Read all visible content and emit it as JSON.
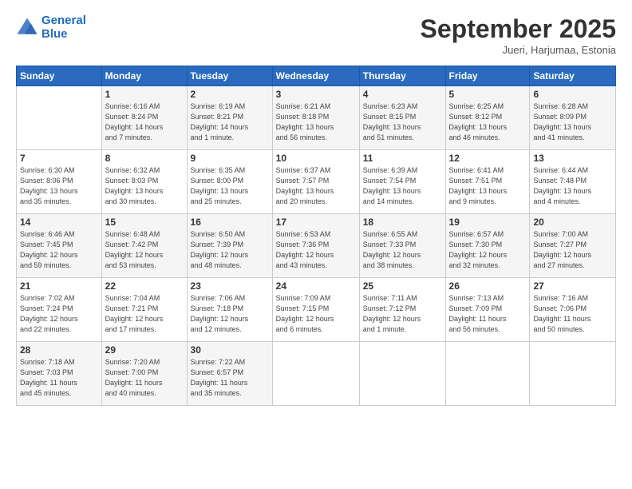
{
  "header": {
    "logo_line1": "General",
    "logo_line2": "Blue",
    "month": "September 2025",
    "location": "Jueri, Harjumaa, Estonia"
  },
  "weekdays": [
    "Sunday",
    "Monday",
    "Tuesday",
    "Wednesday",
    "Thursday",
    "Friday",
    "Saturday"
  ],
  "weeks": [
    [
      {
        "day": "",
        "info": ""
      },
      {
        "day": "1",
        "info": "Sunrise: 6:16 AM\nSunset: 8:24 PM\nDaylight: 14 hours\nand 7 minutes."
      },
      {
        "day": "2",
        "info": "Sunrise: 6:19 AM\nSunset: 8:21 PM\nDaylight: 14 hours\nand 1 minute."
      },
      {
        "day": "3",
        "info": "Sunrise: 6:21 AM\nSunset: 8:18 PM\nDaylight: 13 hours\nand 56 minutes."
      },
      {
        "day": "4",
        "info": "Sunrise: 6:23 AM\nSunset: 8:15 PM\nDaylight: 13 hours\nand 51 minutes."
      },
      {
        "day": "5",
        "info": "Sunrise: 6:25 AM\nSunset: 8:12 PM\nDaylight: 13 hours\nand 46 minutes."
      },
      {
        "day": "6",
        "info": "Sunrise: 6:28 AM\nSunset: 8:09 PM\nDaylight: 13 hours\nand 41 minutes."
      }
    ],
    [
      {
        "day": "7",
        "info": "Sunrise: 6:30 AM\nSunset: 8:06 PM\nDaylight: 13 hours\nand 35 minutes."
      },
      {
        "day": "8",
        "info": "Sunrise: 6:32 AM\nSunset: 8:03 PM\nDaylight: 13 hours\nand 30 minutes."
      },
      {
        "day": "9",
        "info": "Sunrise: 6:35 AM\nSunset: 8:00 PM\nDaylight: 13 hours\nand 25 minutes."
      },
      {
        "day": "10",
        "info": "Sunrise: 6:37 AM\nSunset: 7:57 PM\nDaylight: 13 hours\nand 20 minutes."
      },
      {
        "day": "11",
        "info": "Sunrise: 6:39 AM\nSunset: 7:54 PM\nDaylight: 13 hours\nand 14 minutes."
      },
      {
        "day": "12",
        "info": "Sunrise: 6:41 AM\nSunset: 7:51 PM\nDaylight: 13 hours\nand 9 minutes."
      },
      {
        "day": "13",
        "info": "Sunrise: 6:44 AM\nSunset: 7:48 PM\nDaylight: 13 hours\nand 4 minutes."
      }
    ],
    [
      {
        "day": "14",
        "info": "Sunrise: 6:46 AM\nSunset: 7:45 PM\nDaylight: 12 hours\nand 59 minutes."
      },
      {
        "day": "15",
        "info": "Sunrise: 6:48 AM\nSunset: 7:42 PM\nDaylight: 12 hours\nand 53 minutes."
      },
      {
        "day": "16",
        "info": "Sunrise: 6:50 AM\nSunset: 7:39 PM\nDaylight: 12 hours\nand 48 minutes."
      },
      {
        "day": "17",
        "info": "Sunrise: 6:53 AM\nSunset: 7:36 PM\nDaylight: 12 hours\nand 43 minutes."
      },
      {
        "day": "18",
        "info": "Sunrise: 6:55 AM\nSunset: 7:33 PM\nDaylight: 12 hours\nand 38 minutes."
      },
      {
        "day": "19",
        "info": "Sunrise: 6:57 AM\nSunset: 7:30 PM\nDaylight: 12 hours\nand 32 minutes."
      },
      {
        "day": "20",
        "info": "Sunrise: 7:00 AM\nSunset: 7:27 PM\nDaylight: 12 hours\nand 27 minutes."
      }
    ],
    [
      {
        "day": "21",
        "info": "Sunrise: 7:02 AM\nSunset: 7:24 PM\nDaylight: 12 hours\nand 22 minutes."
      },
      {
        "day": "22",
        "info": "Sunrise: 7:04 AM\nSunset: 7:21 PM\nDaylight: 12 hours\nand 17 minutes."
      },
      {
        "day": "23",
        "info": "Sunrise: 7:06 AM\nSunset: 7:18 PM\nDaylight: 12 hours\nand 12 minutes."
      },
      {
        "day": "24",
        "info": "Sunrise: 7:09 AM\nSunset: 7:15 PM\nDaylight: 12 hours\nand 6 minutes."
      },
      {
        "day": "25",
        "info": "Sunrise: 7:11 AM\nSunset: 7:12 PM\nDaylight: 12 hours\nand 1 minute."
      },
      {
        "day": "26",
        "info": "Sunrise: 7:13 AM\nSunset: 7:09 PM\nDaylight: 11 hours\nand 56 minutes."
      },
      {
        "day": "27",
        "info": "Sunrise: 7:16 AM\nSunset: 7:06 PM\nDaylight: 11 hours\nand 50 minutes."
      }
    ],
    [
      {
        "day": "28",
        "info": "Sunrise: 7:18 AM\nSunset: 7:03 PM\nDaylight: 11 hours\nand 45 minutes."
      },
      {
        "day": "29",
        "info": "Sunrise: 7:20 AM\nSunset: 7:00 PM\nDaylight: 11 hours\nand 40 minutes."
      },
      {
        "day": "30",
        "info": "Sunrise: 7:22 AM\nSunset: 6:57 PM\nDaylight: 11 hours\nand 35 minutes."
      },
      {
        "day": "",
        "info": ""
      },
      {
        "day": "",
        "info": ""
      },
      {
        "day": "",
        "info": ""
      },
      {
        "day": "",
        "info": ""
      }
    ]
  ]
}
